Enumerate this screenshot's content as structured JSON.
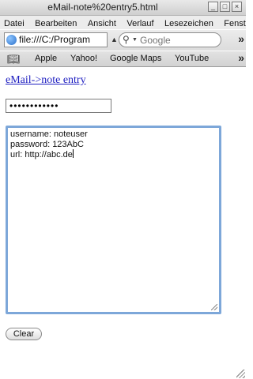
{
  "window": {
    "title": "eMail-note%20entry5.html",
    "controls": [
      "_",
      "□",
      "×"
    ]
  },
  "menu": [
    "Datei",
    "Bearbeiten",
    "Ansicht",
    "Verlauf",
    "Lesezeichen",
    "Fenster"
  ],
  "nav": {
    "url": "file:///C:/Program",
    "search_placeholder": "Google",
    "overflow": "»"
  },
  "bookmarks": {
    "items": [
      "Apple",
      "Yahoo!",
      "Google Maps",
      "YouTube"
    ],
    "overflow": "»"
  },
  "page": {
    "link_text": "eMail->note entry",
    "password_masked": "••••••••••••",
    "notes": {
      "lines": [
        "username: noteuser",
        "password: 123AbC",
        "url: http://abc.de"
      ]
    },
    "clear_label": "Clear"
  }
}
